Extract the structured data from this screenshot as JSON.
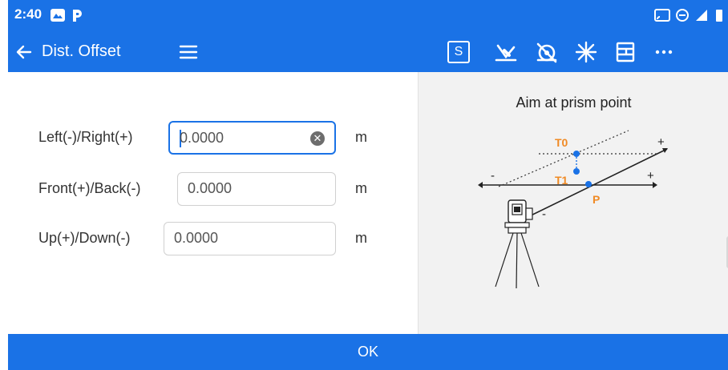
{
  "status": {
    "time": "2:40"
  },
  "toolbar": {
    "title": "Dist. Offset",
    "s_label": "S"
  },
  "form": {
    "rows": [
      {
        "label": "Left(-)/Right(+)",
        "value": "0.0000",
        "unit": "m"
      },
      {
        "label": "Front(+)/Back(-)",
        "value": "0.0000",
        "unit": "m"
      },
      {
        "label": "Up(+)/Down(-)",
        "value": "0.0000",
        "unit": "m"
      }
    ]
  },
  "diagram": {
    "title": "Aim at prism point",
    "labels": {
      "t0": "T0",
      "t1": "T1",
      "p": "P",
      "minus_left": "-",
      "plus_top": "+",
      "plus_mid": "+",
      "minus_bottom": "-"
    },
    "colors": {
      "point": "#1a72e6",
      "label": "#f08a24",
      "line": "#222222"
    }
  },
  "footer": {
    "ok_label": "OK"
  },
  "colors": {
    "primary": "#1a72e6",
    "panel": "#f2f2f2"
  }
}
